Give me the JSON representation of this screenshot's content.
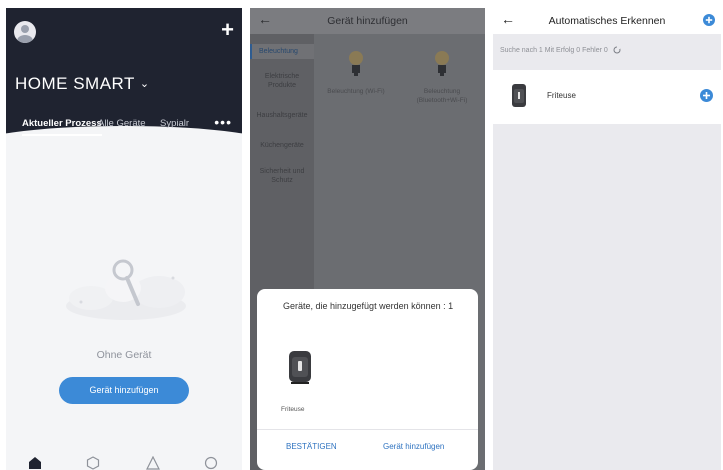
{
  "panel1": {
    "home_title": "HOME SMART",
    "tabs": [
      "Aktueller Prozess",
      "Alle Geräte",
      "Sypialr"
    ],
    "more": "•••",
    "empty_text": "Ohne Gerät",
    "add_button": "Gerät hinzufügen",
    "nav_icons": [
      "home-icon",
      "scene-icon",
      "smart-icon",
      "profile-icon"
    ]
  },
  "panel2": {
    "title": "Gerät hinzufügen",
    "categories": [
      "Beleuchtung",
      "Elektrische Produkte",
      "Haushaltsgeräte",
      "Küchengeräte",
      "Sicherheit und Schutz"
    ],
    "products": [
      "Beleuchtung (Wi-Fi)",
      "Beleuchtung (Bluetooth+Wi-Fi)"
    ],
    "dialog": {
      "message": "Geräte, die hinzugefügt werden können : 1",
      "device": "Friteuse",
      "confirm": "BESTÄTIGEN",
      "add": "Gerät hinzufügen"
    }
  },
  "panel3": {
    "title": "Automatisches Erkennen",
    "status": "Suche nach 1   Mit Erfolg 0   Fehler 0",
    "device": "Friteuse"
  },
  "colors": {
    "header_dark": "#1f2330",
    "accent_blue": "#3c8ad7",
    "overlay_gray": "#6b6d71",
    "list_bg": "#eaeaee"
  }
}
